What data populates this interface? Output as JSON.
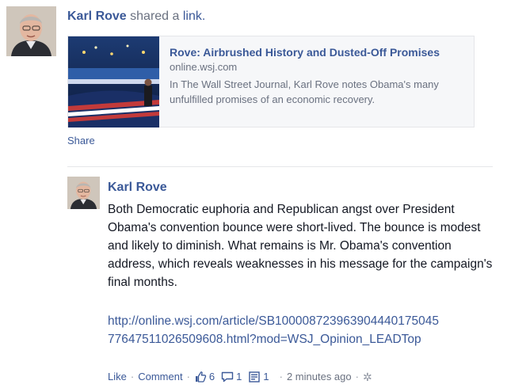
{
  "story": {
    "actor_name": "Karl Rove",
    "verb_text": "shared a",
    "object_word": "link.",
    "share_label": "Share"
  },
  "shared_link": {
    "title": "Rove: Airbrushed History and Dusted-Off Promises",
    "domain": "online.wsj.com",
    "description": "In The Wall Street Journal, Karl Rove notes Obama's many unfulfilled promises of an economic recovery."
  },
  "comment": {
    "author": "Karl Rove",
    "body": "Both Democratic euphoria and Republican angst over President Obama's convention bounce were short-lived. The bounce is modest and likely to diminish. What remains is Mr. Obama's convention address, which reveals weaknesses in his message for the campaign's final months.",
    "link": "http://online.wsj.com/article/SB10000872396390444017504577647511026509608.html?mod=WSJ_Opinion_LEADTop",
    "actions": {
      "like": "Like",
      "comment": "Comment",
      "likes_count": "6",
      "comments_count": "1",
      "shares_count": "1",
      "timestamp": "2 minutes ago"
    }
  },
  "icons": {
    "like": "thumbs-up-icon",
    "comment": "speech-bubble-icon",
    "share": "share-page-icon",
    "settings": "gear-icon"
  },
  "colors": {
    "link_blue": "#3b5998",
    "meta_gray": "#6a7180",
    "card_bg": "#f6f7f9"
  }
}
